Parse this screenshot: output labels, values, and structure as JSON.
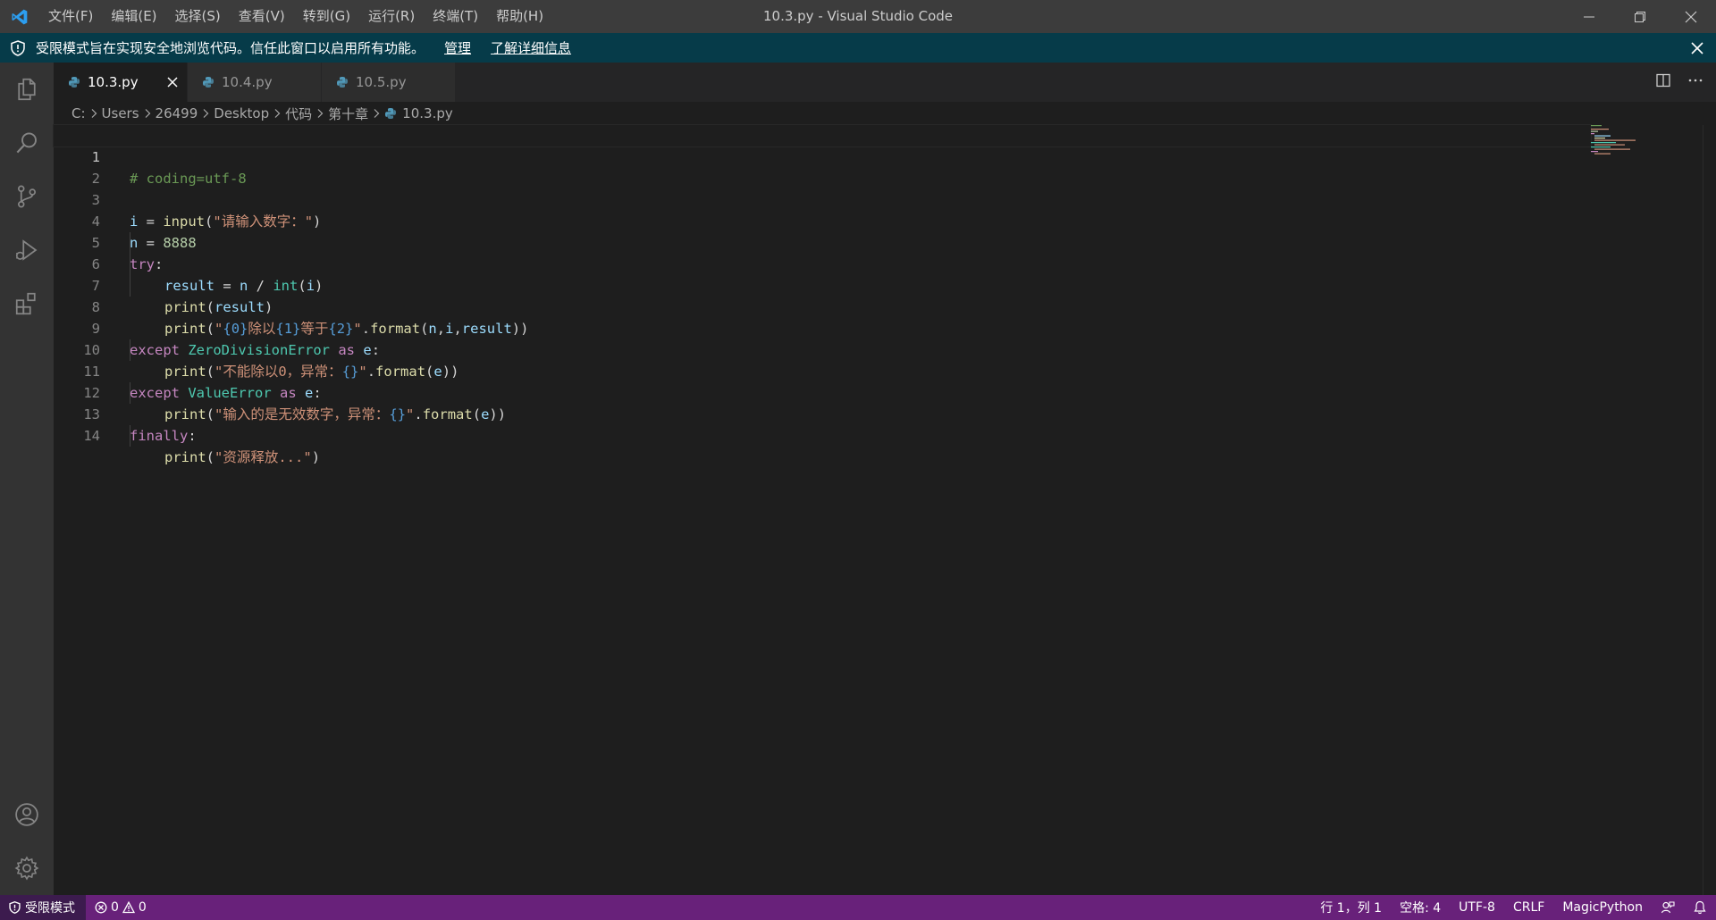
{
  "window": {
    "title": "10.3.py - Visual Studio Code"
  },
  "menu": [
    "文件(F)",
    "编辑(E)",
    "选择(S)",
    "查看(V)",
    "转到(G)",
    "运行(R)",
    "终端(T)",
    "帮助(H)"
  ],
  "banner": {
    "message": "受限模式旨在实现安全地浏览代码。信任此窗口以启用所有功能。",
    "manage": "管理",
    "learn_more": "了解详细信息"
  },
  "tabs": [
    {
      "label": "10.3.py",
      "active": true
    },
    {
      "label": "10.4.py",
      "active": false
    },
    {
      "label": "10.5.py",
      "active": false
    }
  ],
  "breadcrumb": [
    "C:",
    "Users",
    "26499",
    "Desktop",
    "代码",
    "第十章",
    "10.3.py"
  ],
  "code": {
    "line_numbers": [
      "1",
      "2",
      "3",
      "4",
      "5",
      "6",
      "7",
      "8",
      "9",
      "10",
      "11",
      "12",
      "13",
      "14"
    ],
    "l1": {
      "comment": "# coding=utf-8"
    },
    "l3": {
      "a": "i",
      "b": " = ",
      "fn": "input",
      "p1": "(",
      "str": "\"请输入数字：\"",
      "p2": ")"
    },
    "l4": {
      "a": "n",
      "b": " = ",
      "num": "8888"
    },
    "l5": {
      "kw": "try",
      "colon": ":"
    },
    "l6": {
      "a": "result",
      "b": " = ",
      "c": "n",
      "d": " / ",
      "fn": "int",
      "e": "(",
      "f": "i",
      "g": ")"
    },
    "l7": {
      "fn": "print",
      "p1": "(",
      "a": "result",
      "p2": ")"
    },
    "l8": {
      "fn": "print",
      "p1": "(",
      "q1": "\"",
      "f0": "{0}",
      "s1": "除以",
      "f1": "{1}",
      "s2": "等于",
      "f2": "{2}",
      "q2": "\"",
      "dot": ".",
      "fmt": "format",
      "p2": "(",
      "a": "n",
      "c1": ",",
      "b": "i",
      "c2": ",",
      "c": "result",
      "p3": "))"
    },
    "l9": {
      "kw": "except",
      "sp": " ",
      "cls": "ZeroDivisionError",
      "sp2": " ",
      "as": "as",
      "sp3": " ",
      "e": "e",
      "colon": ":"
    },
    "l10": {
      "fn": "print",
      "p1": "(",
      "s": "\"不能除以0，异常：",
      "f": "{}",
      "q": "\"",
      "dot": ".",
      "fmt": "format",
      "p2": "(",
      "e": "e",
      "p3": "))"
    },
    "l11": {
      "kw": "except",
      "sp": " ",
      "cls": "ValueError",
      "sp2": " ",
      "as": "as",
      "sp3": " ",
      "e": "e",
      "colon": ":"
    },
    "l12": {
      "fn": "print",
      "p1": "(",
      "s": "\"输入的是无效数字，异常：",
      "f": "{}",
      "q": "\"",
      "dot": ".",
      "fmt": "format",
      "p2": "(",
      "e": "e",
      "p3": "))"
    },
    "l13": {
      "kw": "finally",
      "colon": ":"
    },
    "l14": {
      "fn": "print",
      "p1": "(",
      "s": "\"资源释放...\"",
      "p2": ")"
    }
  },
  "status": {
    "mode": "受限模式",
    "errors": "0",
    "warnings": "0",
    "position": "行 1，列 1",
    "spaces": "空格: 4",
    "encoding": "UTF-8",
    "eol": "CRLF",
    "language": "MagicPython"
  },
  "colors": {
    "titlebar": "#3c3c3c",
    "banner": "#063b49",
    "statusbar": "#68217a",
    "activitybar": "#333333",
    "editor": "#1e1e1e",
    "python_icon": "#519aba"
  }
}
